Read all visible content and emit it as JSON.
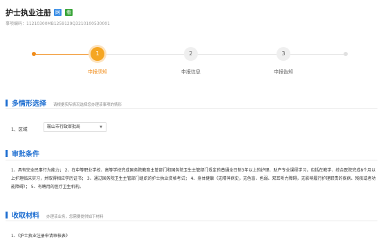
{
  "header": {
    "title": "护士执业注册",
    "badge_web": "网",
    "badge_mobile": "看",
    "code": "事项编码：11210300MB1259129Q3210100530001"
  },
  "steps": [
    {
      "number": "1",
      "label": "申报须知"
    },
    {
      "number": "2",
      "label": "申报信息"
    },
    {
      "number": "3",
      "label": "申报告知"
    }
  ],
  "situation": {
    "title": "多情形选择",
    "hint": "请根据实际情况选择您办理该事项的情形",
    "region_label": "1、区域",
    "region_value": "鞍山市行政审批局"
  },
  "approval": {
    "title": "审批条件",
    "text": "1、具有完全民事行为能力；  2、在中等职业学校、高等学校完成国务院教育主管部门和国务院卫生主管部门规定的普通全日制3年以上的护理、助产专业课程学习，包括在教学、综合医院完成8个月以上护理临床实习，并取得相应学历证书；  3、通过国务院卫生主管部门组织的护士执业资格考试；  4、身体健康（无精神病史，无色盲、色弱、双耳听力障碍，无影响履行护理职责的疾病、残疾或者功能障碍）；  5、有聘用的医疗卫生机构。"
  },
  "materials": {
    "title": "收取材料",
    "hint": "办理该业务，您需要提供如下材料",
    "items": [
      "1、《护士执业注册申请审核表》"
    ]
  },
  "colors": {
    "accent": "#f08c1a",
    "section_blue": "#1f6fd1"
  }
}
